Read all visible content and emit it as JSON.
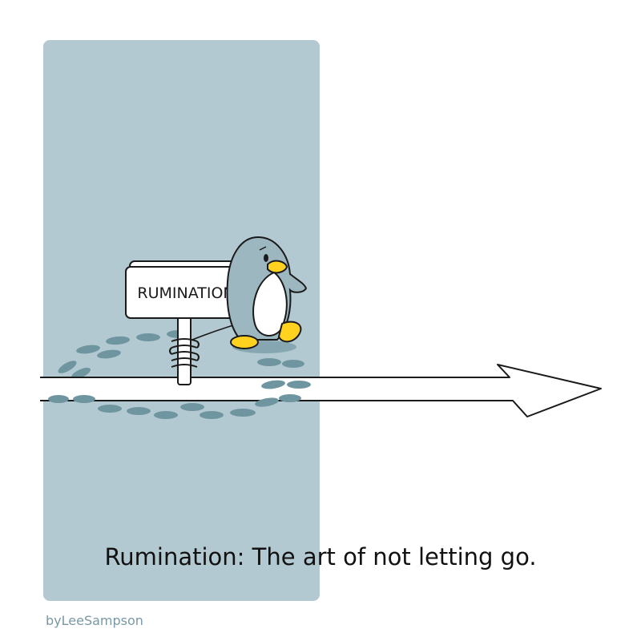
{
  "comic": {
    "sign_label": "RUMINATION",
    "caption": "Rumination: The art of not letting go.",
    "credit": "byLeeSampson"
  },
  "colors": {
    "panel": "#b3c9d1",
    "footprint": "#6f95a0",
    "penguin_body": "#9db7c1",
    "penguin_beak": "#ffd21f",
    "outline": "#1a1a1a"
  },
  "icons": {
    "character": "penguin",
    "sign": "signpost-with-spring",
    "arrow": "long-arrow-right"
  }
}
